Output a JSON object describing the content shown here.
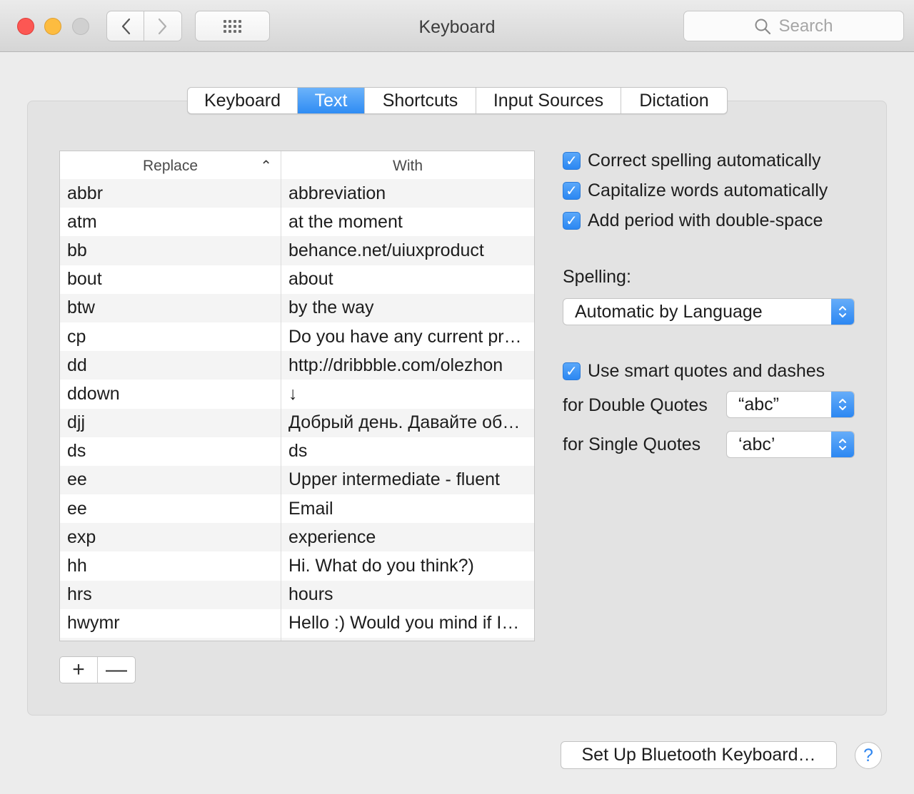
{
  "window": {
    "title": "Keyboard"
  },
  "toolbar": {
    "search_placeholder": "Search"
  },
  "tabs": [
    {
      "label": "Keyboard",
      "active": false
    },
    {
      "label": "Text",
      "active": true
    },
    {
      "label": "Shortcuts",
      "active": false
    },
    {
      "label": "Input Sources",
      "active": false
    },
    {
      "label": "Dictation",
      "active": false
    }
  ],
  "table": {
    "columns": {
      "replace": "Replace",
      "with": "With"
    },
    "rows": [
      {
        "replace": "abbr",
        "with": "abbreviation"
      },
      {
        "replace": "atm",
        "with": "at the moment"
      },
      {
        "replace": "bb",
        "with": "behance.net/uiuxproduct"
      },
      {
        "replace": "bout",
        "with": "about"
      },
      {
        "replace": "btw",
        "with": "by the way"
      },
      {
        "replace": "cp",
        "with": "Do you have any current pr…"
      },
      {
        "replace": "dd",
        "with": "http://dribbble.com/olezhon"
      },
      {
        "replace": "ddown",
        "with": "↓"
      },
      {
        "replace": "djj",
        "with": "Добрый день. Давайте об…"
      },
      {
        "replace": "ds",
        "with": "ds"
      },
      {
        "replace": "ee",
        "with": "Upper intermediate - fluent"
      },
      {
        "replace": "ee",
        "with": "Email"
      },
      {
        "replace": "exp",
        "with": "experience"
      },
      {
        "replace": "hh",
        "with": "Hi. What do you think?)"
      },
      {
        "replace": "hrs",
        "with": "hours"
      },
      {
        "replace": "hwymr",
        "with": "Hello :) Would you mind if I…"
      },
      {
        "replace": "",
        "with": ""
      }
    ],
    "add_label": "+",
    "remove_label": "—"
  },
  "options": {
    "correct_spelling": "Correct spelling automatically",
    "capitalize": "Capitalize words automatically",
    "period": "Add period with double-space",
    "spelling_label": "Spelling:",
    "spelling_value": "Automatic by Language",
    "smart_quotes": "Use smart quotes and dashes",
    "double_label": "for Double Quotes",
    "double_value": "“abc”",
    "single_label": "for Single Quotes",
    "single_value": "‘abc’"
  },
  "footer": {
    "bluetooth_button": "Set Up Bluetooth Keyboard…",
    "help": "?"
  }
}
